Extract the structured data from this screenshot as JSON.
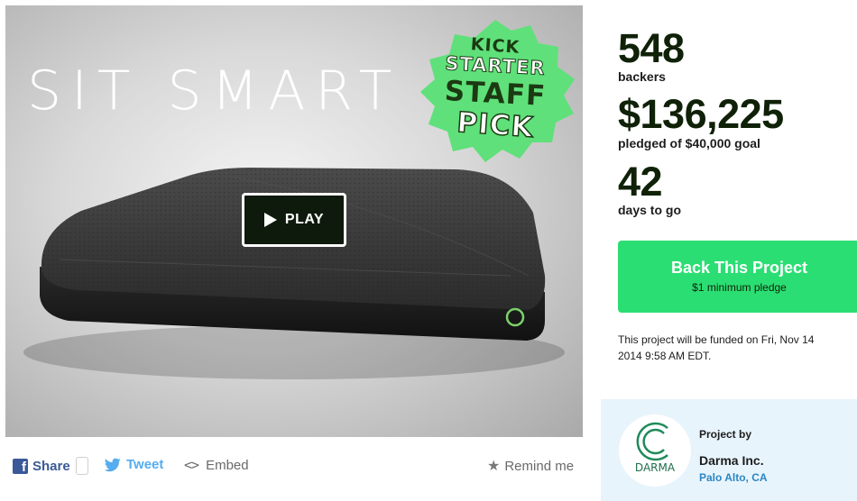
{
  "video": {
    "headline": "SIT SMART",
    "play_label": "PLAY",
    "sticker": {
      "line1": "KICK",
      "line2": "STARTER",
      "line3": "STAFF",
      "line4": "PICK"
    }
  },
  "share_bar": {
    "share_label": "Share",
    "tweet_label": "Tweet",
    "embed_label": "Embed",
    "remind_label": "Remind me"
  },
  "stats": {
    "backers_value": "548",
    "backers_label": "backers",
    "pledged_value": "$136,225",
    "pledged_label": "pledged of $40,000 goal",
    "days_value": "42",
    "days_label": "days to go"
  },
  "cta": {
    "title": "Back This Project",
    "subtitle": "$1 minimum pledge"
  },
  "funding_note": "This project will be funded on Fri, Nov 14 2014 9:58 AM EDT.",
  "creator": {
    "project_by_label": "Project by",
    "name": "Darma Inc.",
    "location": "Palo Alto, CA",
    "logo_text": "DARMA"
  },
  "colors": {
    "accent_green": "#2bde73",
    "sticker_green": "#5fe07a",
    "dark_text": "#0f2107",
    "link_blue": "#2b86c4",
    "facebook_blue": "#3b5998",
    "twitter_blue": "#55acee",
    "creator_bg": "#e8f4fc"
  },
  "icons": {
    "play": "play-icon",
    "facebook": "facebook-icon",
    "twitter": "twitter-icon",
    "embed": "code-brackets-icon",
    "remind": "star-icon"
  }
}
